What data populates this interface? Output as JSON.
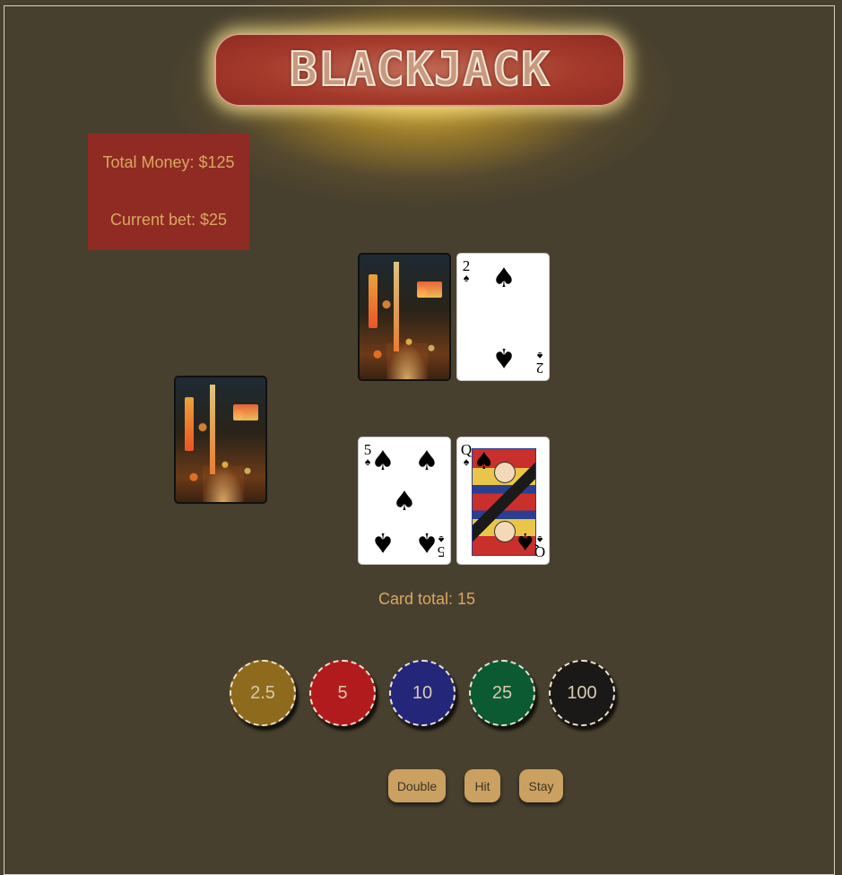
{
  "title": "BLACKJACK",
  "money": {
    "total_label": "Total Money: $125",
    "bet_label": "Current bet: $25"
  },
  "dealer": {
    "cards": [
      {
        "face": "down"
      },
      {
        "face": "up",
        "rank": "2",
        "suit": "spades",
        "suit_symbol": "♠"
      }
    ]
  },
  "player": {
    "cards": [
      {
        "face": "up",
        "rank": "5",
        "suit": "spades",
        "suit_symbol": "♠"
      },
      {
        "face": "up",
        "rank": "Q",
        "suit": "spades",
        "suit_symbol": "♠"
      }
    ],
    "total_label": "Card total: 15"
  },
  "deck": {
    "face": "down"
  },
  "chips": [
    {
      "label": "2.5",
      "color": "#8e6a1c"
    },
    {
      "label": "5",
      "color": "#b11b1d"
    },
    {
      "label": "10",
      "color": "#24267a"
    },
    {
      "label": "25",
      "color": "#0c5a32"
    },
    {
      "label": "100",
      "color": "#1a1918"
    }
  ],
  "actions": {
    "double": "Double",
    "hit": "Hit",
    "stay": "Stay"
  },
  "colors": {
    "felt": "#48402f",
    "money_box": "#8f2b23",
    "text_gold": "#d9a860",
    "button": "#caa160"
  }
}
